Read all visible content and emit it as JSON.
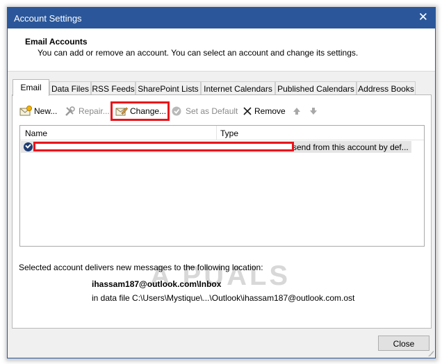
{
  "window": {
    "title": "Account Settings"
  },
  "header": {
    "title": "Email Accounts",
    "description": "You can add or remove an account. You can select an account and change its settings."
  },
  "tabs": [
    "Email",
    "Data Files",
    "RSS Feeds",
    "SharePoint Lists",
    "Internet Calendars",
    "Published Calendars",
    "Address Books"
  ],
  "toolbar": {
    "new_label": "New...",
    "repair_label": "Repair...",
    "change_label": "Change...",
    "set_default_label": "Set as Default",
    "remove_label": "Remove"
  },
  "list": {
    "columns": {
      "name": "Name",
      "type": "Type"
    },
    "rows": [
      {
        "type": "send from this account by def..."
      }
    ]
  },
  "watermark": "A PUALS",
  "delivery": {
    "label": "Selected account delivers new messages to the following location:",
    "path": "ihassam187@outlook.com\\Inbox",
    "file": "in data file C:\\Users\\Mystique\\...\\Outlook\\ihassam187@outlook.com.ost"
  },
  "buttons": {
    "close_label": "Close"
  },
  "colors": {
    "titlebar": "#2b579a",
    "highlight": "#e8141b",
    "selected_row": "#e5e5e5"
  }
}
